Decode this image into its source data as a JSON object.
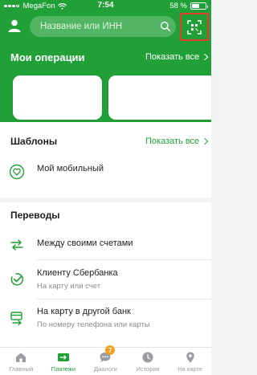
{
  "status_bar": {
    "carrier": "MegaFon",
    "time": "7:54",
    "battery": "58 %",
    "battery_level": 0.58
  },
  "header": {
    "search_placeholder": "Название или ИНН",
    "icons": [
      "profile-icon",
      "search-icon",
      "qr-scan-icon"
    ]
  },
  "operations": {
    "title": "Мои операции",
    "show_all": "Показать все"
  },
  "templates": {
    "title": "Шаблоны",
    "show_all": "Показать все",
    "items": [
      {
        "title": "Мой мобильный",
        "icon": "heart-icon"
      }
    ]
  },
  "transfers": {
    "title": "Переводы",
    "items": [
      {
        "title": "Между своими счетами",
        "subtitle": "",
        "icon": "transfer-arrows-icon"
      },
      {
        "title": "Клиенту Сбербанка",
        "subtitle": "На карту или счет",
        "icon": "sber-client-icon"
      },
      {
        "title": "На карту в другой банк",
        "subtitle": "По номеру телефона или карты",
        "icon": "card-transfer-icon"
      }
    ]
  },
  "tabbar": {
    "items": [
      {
        "label": "Главный",
        "icon": "home-icon",
        "active": false
      },
      {
        "label": "Платежи",
        "icon": "payments-icon",
        "active": true
      },
      {
        "label": "Диалоги",
        "icon": "chat-icon",
        "active": false,
        "badge": "7"
      },
      {
        "label": "История",
        "icon": "history-icon",
        "active": false
      },
      {
        "label": "На карте",
        "icon": "map-pin-icon",
        "active": false
      }
    ]
  },
  "colors": {
    "brand_green": "#21a038",
    "highlight_red": "#ea3b2f",
    "badge_orange": "#f6a020"
  }
}
